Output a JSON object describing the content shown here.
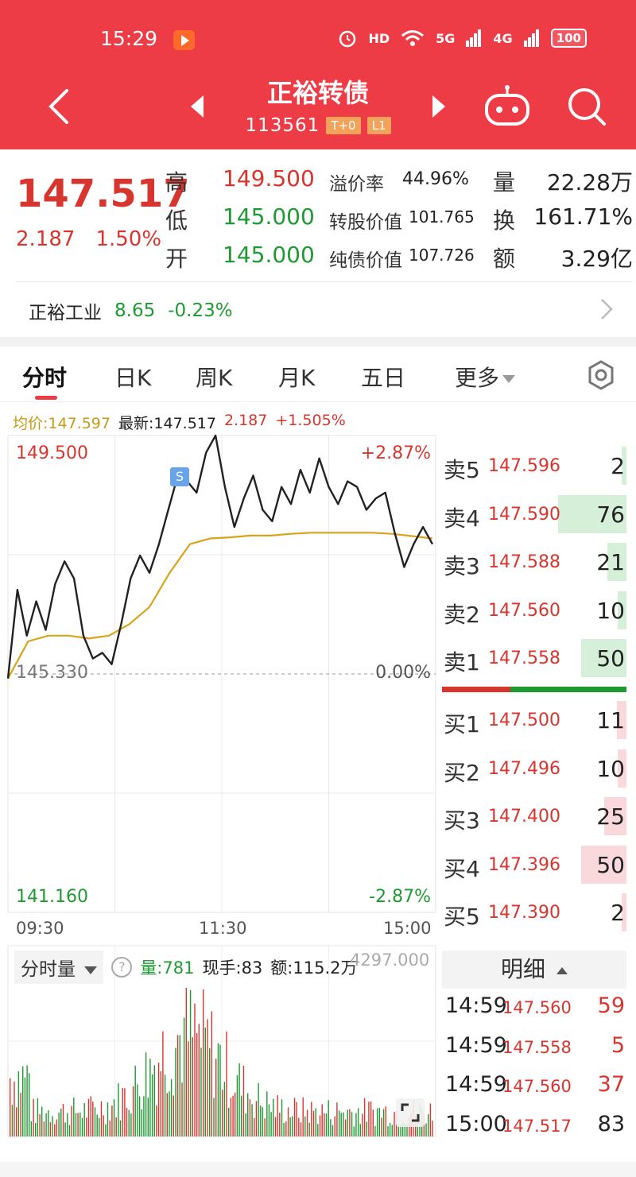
{
  "status_bar": {
    "time": "15:29",
    "items": [
      "HD",
      "5G",
      "4G"
    ],
    "battery": "100"
  },
  "header": {
    "title": "正裕转债",
    "code": "113561",
    "badges": [
      "T+0",
      "L1"
    ],
    "icons": [
      "back-arrow-icon",
      "prev-triangle-icon",
      "next-triangle-icon",
      "robot-icon",
      "search-icon"
    ]
  },
  "quote": {
    "price": "147.517",
    "change": "2.187",
    "change_pct": "1.50%",
    "high_label": "高",
    "high": "149.500",
    "low_label": "低",
    "low": "145.000",
    "open_label": "开",
    "open": "145.000",
    "premium_label": "溢价率",
    "premium": "44.96%",
    "conv_value_label": "转股价值",
    "conv_value": "101.765",
    "bond_value_label": "纯债价值",
    "bond_value": "107.726",
    "volume_label": "量",
    "volume": "22.28万",
    "turnover_label": "换",
    "turnover": "161.71%",
    "amount_label": "额",
    "amount": "3.29亿"
  },
  "underlying": {
    "name": "正裕工业",
    "price": "8.65",
    "change_pct": "-0.23%"
  },
  "tabs": [
    "分时",
    "日K",
    "周K",
    "月K",
    "五日",
    "更多"
  ],
  "legend": {
    "avg_label": "均价:",
    "avg": "147.597",
    "last_label": "最新:",
    "last": "147.517",
    "chg": "2.187",
    "chg_pct": "+1.505%"
  },
  "chart": {
    "y_top": "149.500",
    "y_mid": "145.330",
    "y_bottom": "141.160",
    "pct_top": "+2.87%",
    "pct_mid": "0.00%",
    "pct_bottom": "-2.87%",
    "times": [
      "09:30",
      "11:30",
      "15:00"
    ],
    "marker": "S",
    "colors": {
      "price_line": "#222222",
      "avg_line": "#d9a319",
      "up": "#d9352f",
      "down": "#1f9a32"
    }
  },
  "chart_data": {
    "type": "line",
    "title": "",
    "xlabel": "",
    "ylabel": "",
    "x_ticks": [
      "09:30",
      "11:30",
      "15:00"
    ],
    "ylim": [
      141.16,
      149.5
    ],
    "reference": 145.33,
    "series": [
      {
        "name": "",
        "values": [
          145.25,
          146.8,
          146.0,
          146.6,
          146.1,
          146.9,
          147.3,
          147.0,
          146.0,
          145.6,
          145.7,
          145.5,
          146.2,
          147.0,
          147.4,
          147.1,
          147.6,
          148.2,
          148.8,
          148.7,
          148.5,
          149.2,
          149.5,
          148.6,
          147.9,
          148.4,
          148.8,
          148.2,
          148.0,
          148.6,
          148.3,
          148.9,
          148.5,
          149.1,
          148.6,
          148.3,
          148.7,
          148.6,
          148.2,
          148.4,
          148.5,
          147.8,
          147.2,
          147.6,
          147.9,
          147.6
        ]
      },
      {
        "name": "",
        "values": [
          145.25,
          145.9,
          146.0,
          146.0,
          145.95,
          146.0,
          146.2,
          146.5,
          147.1,
          147.6,
          147.7,
          147.72,
          147.75,
          147.75,
          147.78,
          147.8,
          147.8,
          147.8,
          147.8,
          147.78,
          147.74,
          147.7
        ]
      }
    ]
  },
  "order_book": {
    "asks": [
      {
        "label": "卖5",
        "price": "147.596",
        "vol": "2",
        "ratio": 0.03
      },
      {
        "label": "卖4",
        "price": "147.590",
        "vol": "76",
        "ratio": 1.0
      },
      {
        "label": "卖3",
        "price": "147.588",
        "vol": "21",
        "ratio": 0.28
      },
      {
        "label": "卖2",
        "price": "147.560",
        "vol": "10",
        "ratio": 0.13
      },
      {
        "label": "卖1",
        "price": "147.558",
        "vol": "50",
        "ratio": 0.66
      }
    ],
    "bids": [
      {
        "label": "买1",
        "price": "147.500",
        "vol": "11",
        "ratio": 0.14
      },
      {
        "label": "买2",
        "price": "147.496",
        "vol": "10",
        "ratio": 0.13
      },
      {
        "label": "买3",
        "price": "147.400",
        "vol": "25",
        "ratio": 0.33
      },
      {
        "label": "买4",
        "price": "147.396",
        "vol": "50",
        "ratio": 0.66
      },
      {
        "label": "买5",
        "price": "147.390",
        "vol": "2",
        "ratio": 0.03
      }
    ]
  },
  "volume": {
    "select_label": "分时量",
    "qty_label": "量:",
    "qty": "781",
    "hand_label": "现手:",
    "hand": "83",
    "amt_label": "额:",
    "amt": "115.2万",
    "max": "4297.000"
  },
  "detail": {
    "title": "明细",
    "rows": [
      {
        "time": "14:59",
        "price": "147.560",
        "vol": "59",
        "dir": "up"
      },
      {
        "time": "14:59",
        "price": "147.558",
        "vol": "5",
        "dir": "up"
      },
      {
        "time": "14:59",
        "price": "147.560",
        "vol": "37",
        "dir": "up"
      },
      {
        "time": "15:00",
        "price": "147.517",
        "vol": "83",
        "dir": "flat"
      }
    ]
  }
}
